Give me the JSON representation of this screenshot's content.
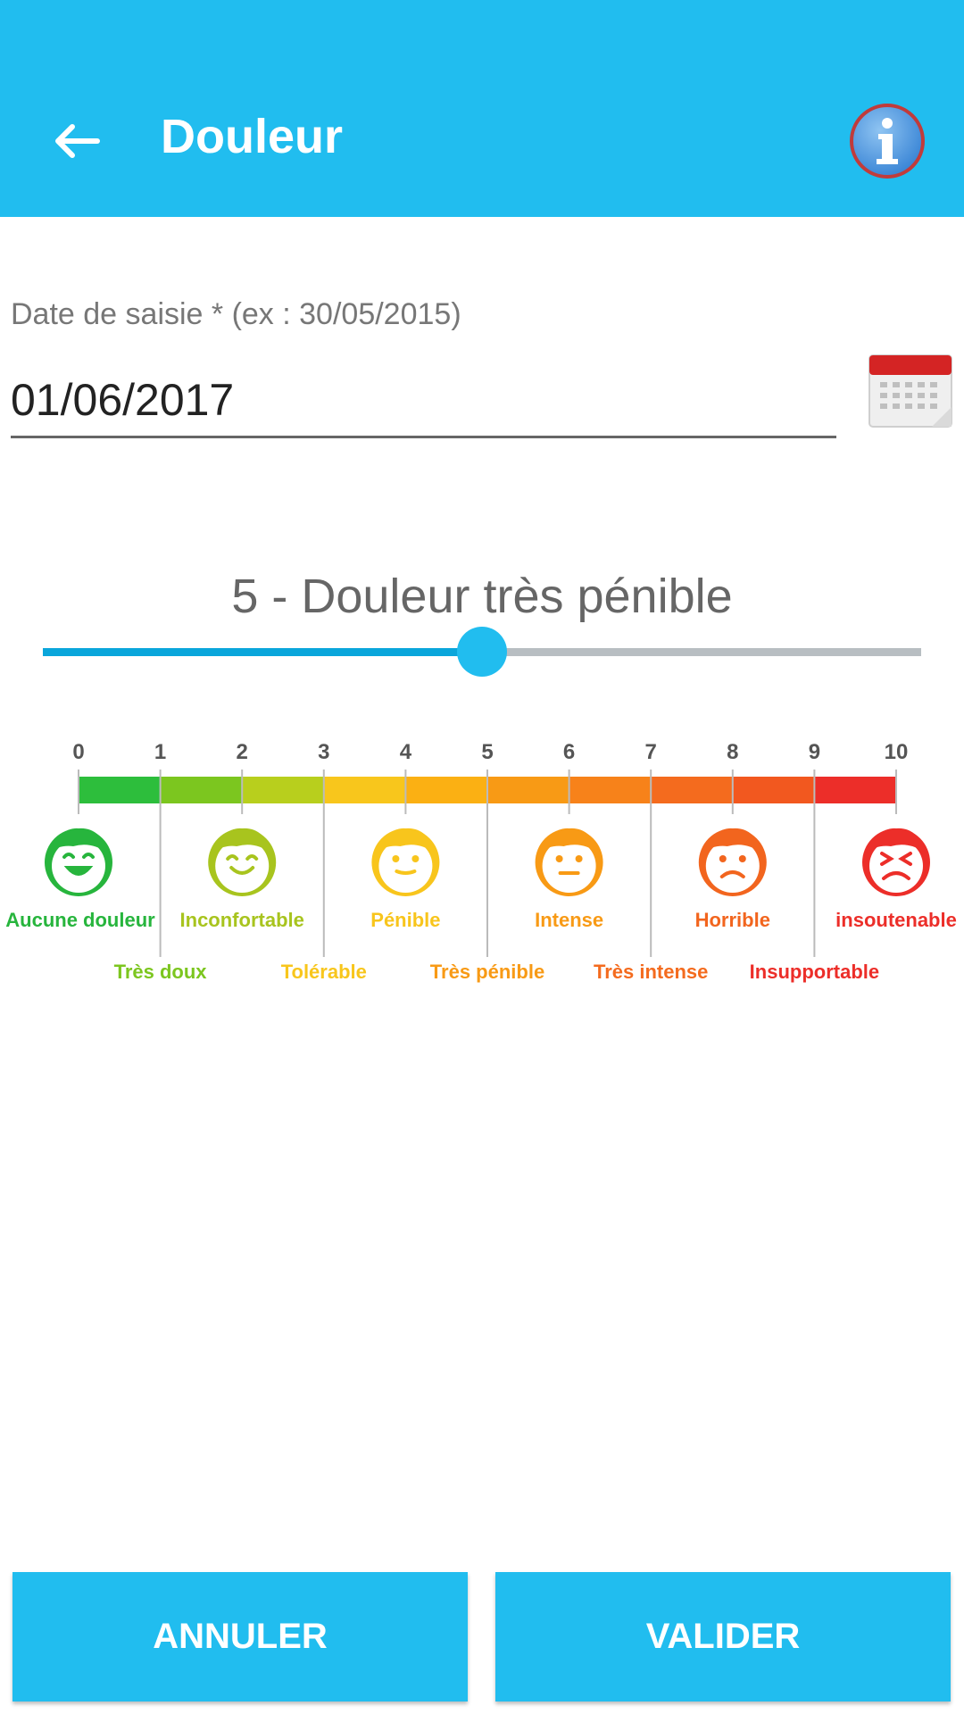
{
  "app_bar": {
    "title": "Douleur",
    "back_icon": "arrow-left-icon",
    "info_icon": "info-icon",
    "background": "#21BDEF"
  },
  "date_field": {
    "label": "Date de saisie * (ex : 30/05/2015)",
    "value": "01/06/2017",
    "calendar_icon": "calendar-icon"
  },
  "pain_slider": {
    "value": 5,
    "min": 0,
    "max": 10,
    "label": "5 - Douleur très pénible"
  },
  "pain_scale": {
    "numbers": [
      "0",
      "1",
      "2",
      "3",
      "4",
      "5",
      "6",
      "7",
      "8",
      "9",
      "10"
    ],
    "top_labels": [
      "Aucune douleur",
      "Inconfortable",
      "Pénible",
      "Intense",
      "Horrible",
      "insoutenable"
    ],
    "bottom_labels": [
      "Très doux",
      "Tolérable",
      "Très pénible",
      "Très intense",
      "Insupportable"
    ],
    "segment_colors": [
      "#2DBE3C",
      "#7CC61F",
      "#B8CF1D",
      "#F8C61C",
      "#FBB013",
      "#F89A15",
      "#F7821A",
      "#F46B1E",
      "#F2581F",
      "#EC2E29"
    ],
    "face_colors": [
      "#27B53D",
      "#A8C41E",
      "#F8C51C",
      "#F89A15",
      "#F2651E",
      "#EC2E29"
    ]
  },
  "actions": {
    "cancel_label": "ANNULER",
    "validate_label": "VALIDER"
  },
  "colors": {
    "accent": "#21BDEF",
    "slider_fill": "#0AA6DB",
    "slider_track": "#B8BEC2"
  }
}
